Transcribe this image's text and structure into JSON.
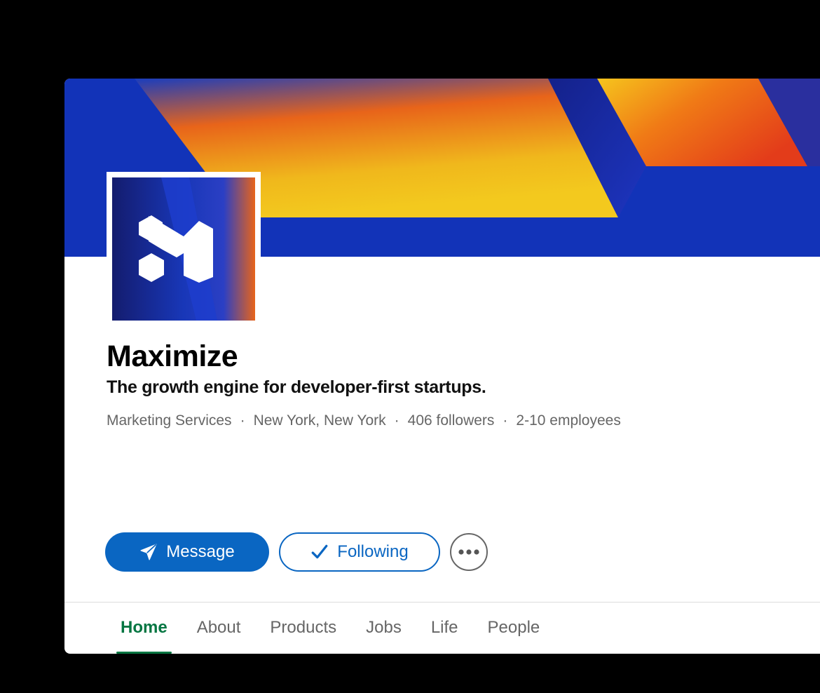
{
  "company": {
    "name": "Maximize",
    "tagline": "The growth engine for developer-first startups.",
    "meta": [
      "Marketing Services",
      "New York, New York",
      "406 followers",
      "2-10 employees"
    ]
  },
  "actions": {
    "message_label": "Message",
    "following_label": "Following",
    "more_icon": "more-horizontal-icon"
  },
  "tabs": [
    {
      "label": "Home",
      "active": true
    },
    {
      "label": "About"
    },
    {
      "label": "Products"
    },
    {
      "label": "Jobs"
    },
    {
      "label": "Life"
    },
    {
      "label": "People"
    }
  ],
  "colors": {
    "brand_blue": "#0a66c2",
    "active_tab": "#057642",
    "banner_blue": "#1233b8",
    "banner_orange": "#e8431a",
    "banner_yellow": "#f0c419"
  }
}
